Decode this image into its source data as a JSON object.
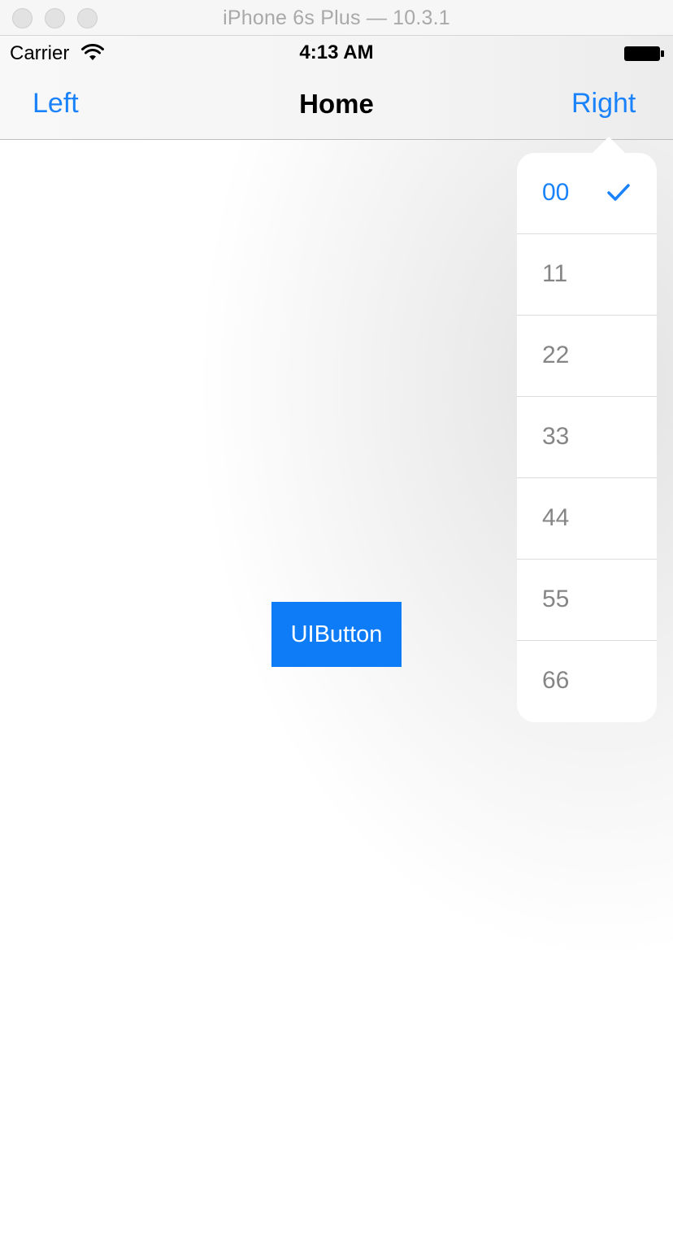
{
  "window": {
    "title": "iPhone 6s Plus — 10.3.1"
  },
  "status_bar": {
    "carrier": "Carrier",
    "time": "4:13 AM",
    "wifi_icon": "wifi-icon",
    "battery_icon": "battery-icon"
  },
  "nav_bar": {
    "left_label": "Left",
    "title": "Home",
    "right_label": "Right"
  },
  "main": {
    "button_label": "UIButton"
  },
  "popover": {
    "selected_index": 0,
    "items": [
      {
        "label": "00",
        "selected": true
      },
      {
        "label": "11",
        "selected": false
      },
      {
        "label": "22",
        "selected": false
      },
      {
        "label": "33",
        "selected": false
      },
      {
        "label": "44",
        "selected": false
      },
      {
        "label": "55",
        "selected": false
      },
      {
        "label": "66",
        "selected": false
      }
    ]
  },
  "colors": {
    "accent": "#1a82fb",
    "button_bg": "#0f7cf7",
    "item_text": "#858585"
  }
}
